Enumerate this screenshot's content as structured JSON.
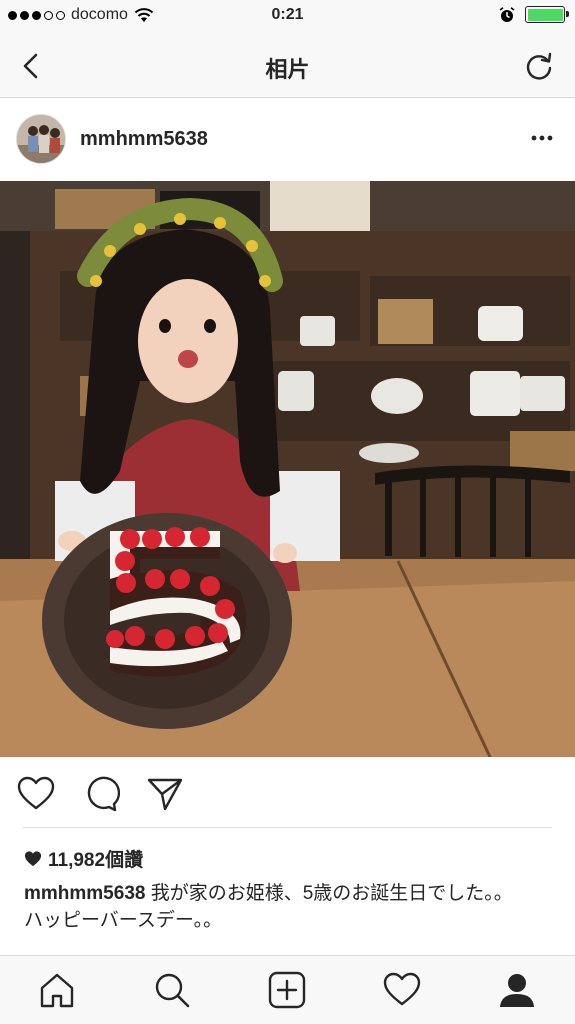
{
  "status_bar": {
    "carrier": "docomo",
    "time": "0:21",
    "battery_color": "#4cd964"
  },
  "nav": {
    "title": "相片",
    "back_icon": "chevron-left-icon",
    "refresh_icon": "refresh-icon"
  },
  "post": {
    "username": "mmhmm5638",
    "likes": "11,982個讚",
    "caption_user": "mmhmm5638",
    "caption_line1": " 我が家のお姫様、5歳のお誕生日でした。。",
    "caption_line2": "ハッピーバースデー。。"
  },
  "icons": {
    "like": "heart-icon",
    "comment": "comment-icon",
    "share": "send-icon",
    "more": "more-icon"
  },
  "tab_bar": [
    "home-icon",
    "search-icon",
    "add-icon",
    "activity-heart-icon",
    "profile-icon"
  ]
}
